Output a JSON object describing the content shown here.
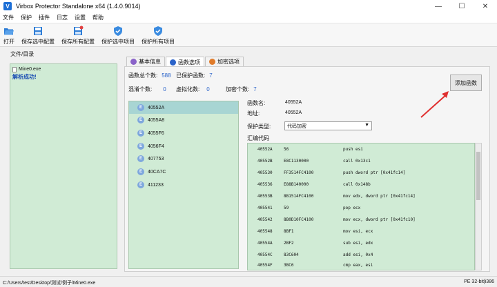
{
  "window": {
    "title": "Virbox Protector Standalone x64 (1.4.0.9014)",
    "app_icon_letter": "V",
    "controls": [
      "—",
      "☐",
      "✕"
    ]
  },
  "menu": [
    "文件",
    "保护",
    "插件",
    "日志",
    "设置",
    "帮助"
  ],
  "toolbar": [
    {
      "label": "打开",
      "icon": "folder-open-icon"
    },
    {
      "label": "保存选中配置",
      "icon": "save-config-icon"
    },
    {
      "label": "保存所有配置",
      "icon": "save-all-config-icon"
    },
    {
      "label": "保护选中项目",
      "icon": "shield-check-icon"
    },
    {
      "label": "保护所有项目",
      "icon": "shield-check-all-icon"
    }
  ],
  "left_panel": {
    "title": "文件/目录",
    "file_name": "Mine0.exe",
    "status": "解析成功!"
  },
  "tabs": [
    {
      "label": "基本信息",
      "color": "#8a63c9",
      "active": false
    },
    {
      "label": "函数选项",
      "color": "#2b63c9",
      "active": true
    },
    {
      "label": "加密选项",
      "color": "#e07b2a",
      "active": false
    }
  ],
  "stats": {
    "total_label": "函数总个数:",
    "total_value": "588",
    "protected_label": "已保护函数:",
    "protected_value": "7",
    "obfuscate_label": "混淆个数:",
    "obfuscate_value": "0",
    "virtualize_label": "虚拟化数:",
    "virtualize_value": "0",
    "encrypt_label": "加密个数:",
    "encrypt_value": "7"
  },
  "add_button_label": "添加函数",
  "functions": [
    "40552A",
    "4055A8",
    "4055F6",
    "4056F4",
    "407753",
    "40CA7C",
    "411233"
  ],
  "detail": {
    "name_label": "函数名:",
    "name_value": "40552A",
    "addr_label": "地址:",
    "addr_value": "40552A",
    "protect_label": "保护类型:",
    "protect_value": "代码加密",
    "asm_label": "汇编代码"
  },
  "asm_rows": [
    [
      "40552A",
      "56",
      "push esi"
    ],
    [
      "40552B",
      "E8C1130000",
      "call 0x13c1"
    ],
    [
      "405530",
      "FF3514FC4100",
      "push dword ptr [0x41fc14]"
    ],
    [
      "405536",
      "E88B140000",
      "call 0x148b"
    ],
    [
      "40553B",
      "8B1514FC4100",
      "mov edx, dword ptr [0x41fc14]"
    ],
    [
      "405541",
      "59",
      "pop ecx"
    ],
    [
      "405542",
      "8B0D10FC4100",
      "mov ecx, dword ptr [0x41fc10]"
    ],
    [
      "405548",
      "8BF1",
      "mov esi, ecx"
    ],
    [
      "40554A",
      "2BF2",
      "sub esi, edx"
    ],
    [
      "40554C",
      "83C604",
      "add esi, 0x4"
    ],
    [
      "40554F",
      "3BC6",
      "cmp eax, esi"
    ]
  ],
  "statusbar": {
    "path": "C:/Users/test/Desktop/测试/例子/Mine0.exe",
    "format": "PE 32-bit|i386"
  }
}
